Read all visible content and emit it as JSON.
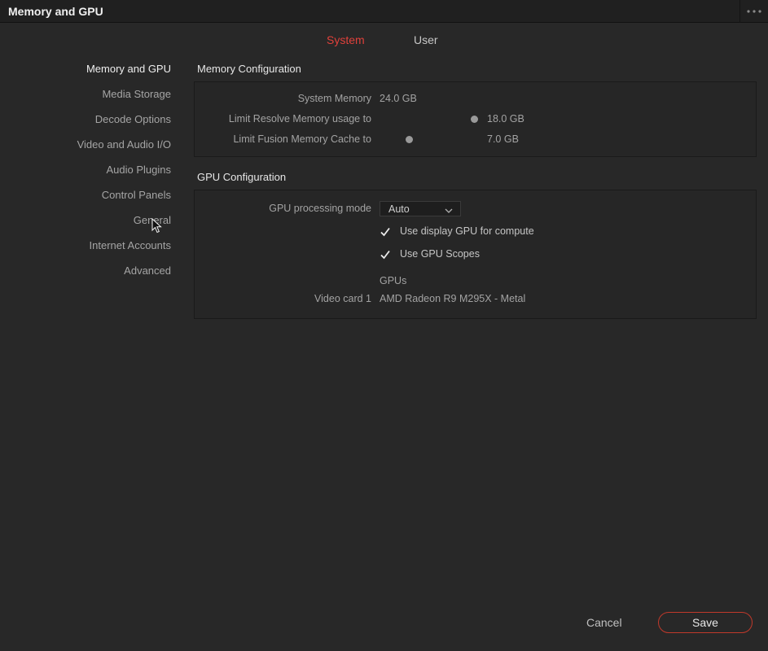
{
  "window": {
    "title": "Memory and GPU"
  },
  "tabs": [
    {
      "label": "System"
    },
    {
      "label": "User"
    }
  ],
  "sidebar": {
    "items": [
      {
        "label": "Memory and GPU"
      },
      {
        "label": "Media Storage"
      },
      {
        "label": "Decode Options"
      },
      {
        "label": "Video and Audio I/O"
      },
      {
        "label": "Audio Plugins"
      },
      {
        "label": "Control Panels"
      },
      {
        "label": "General"
      },
      {
        "label": "Internet Accounts"
      },
      {
        "label": "Advanced"
      }
    ]
  },
  "memory": {
    "title": "Memory Configuration",
    "system_memory_label": "System Memory",
    "system_memory_value": "24.0 GB",
    "resolve_label": "Limit Resolve Memory usage to",
    "resolve_value": "18.0 GB",
    "fusion_label": "Limit Fusion Memory Cache to",
    "fusion_value": "7.0 GB"
  },
  "gpu": {
    "title": "GPU Configuration",
    "mode_label": "GPU processing mode",
    "mode_value": "Auto",
    "display_gpu_label": "Use display GPU for compute",
    "display_gpu_checked": true,
    "scopes_label": "Use GPU Scopes",
    "scopes_checked": true,
    "gpus_header": "GPUs",
    "card_label": "Video card 1",
    "card_value": "AMD Radeon R9 M295X - Metal"
  },
  "footer": {
    "cancel": "Cancel",
    "save": "Save"
  },
  "colors": {
    "accent": "#e0413b",
    "background": "#282828",
    "titlebar": "#202020"
  },
  "icons": [
    "more-horizontal-icon",
    "chevron-down-icon",
    "checkmark-icon",
    "mouse-pointer-icon"
  ]
}
